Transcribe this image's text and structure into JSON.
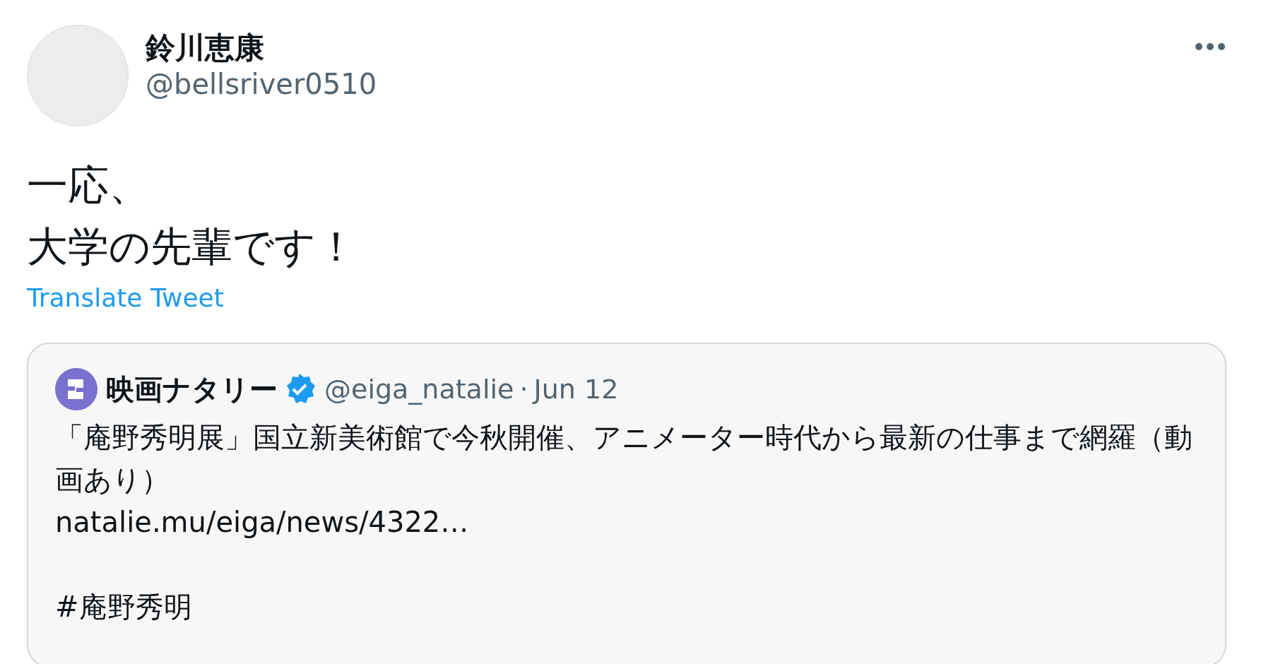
{
  "author": {
    "name": "鈴川恵康",
    "handle": "@bellsriver0510"
  },
  "tweet_lines": [
    "一応、",
    "大学の先輩です！"
  ],
  "translate_link": "Translate Tweet",
  "quoted": {
    "name": "映画ナタリー",
    "verified": true,
    "handle": "@eiga_natalie",
    "separator": "·",
    "date": "Jun 12",
    "paragraphs": [
      [
        "「庵野秀明展」国立新美術館で今秋開催、アニメーター時代から最新の仕事まで網羅（動画あり）",
        "natalie.mu/eiga/news/4322…"
      ],
      [
        "#庵野秀明"
      ]
    ]
  }
}
